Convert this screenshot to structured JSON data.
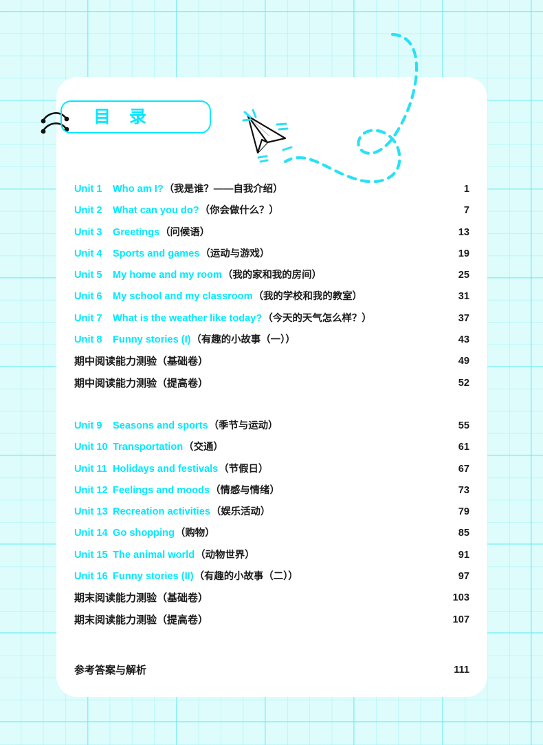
{
  "title": {
    "heading": "目 录"
  },
  "decor": {
    "paper_plane_icon": "paper-plane-icon",
    "flight_trail_icon": "dashed-flight-path-icon",
    "squiggle_icon": "double-arc-squiggle-icon"
  },
  "colors": {
    "accent_cyan": "#00e8ff",
    "grid_line": "#8af1f6",
    "grid_bg": "#ddfcfb",
    "card_bg": "#ffffff",
    "text_black": "#1a1a1a"
  },
  "toc": {
    "block1": [
      {
        "unit": "Unit 1",
        "en": "Who am I?",
        "cn": "（我是谁？——自我介绍）",
        "page": "1"
      },
      {
        "unit": "Unit 2",
        "en": "What can you do?",
        "cn": "（你会做什么？）",
        "page": "7"
      },
      {
        "unit": "Unit 3",
        "en": "Greetings",
        "cn": "（问候语）",
        "page": "13"
      },
      {
        "unit": "Unit 4",
        "en": "Sports and games",
        "cn": "（运动与游戏）",
        "page": "19"
      },
      {
        "unit": "Unit 5",
        "en": "My home and my room",
        "cn": "（我的家和我的房间）",
        "page": "25"
      },
      {
        "unit": "Unit 6",
        "en": "My school and my classroom",
        "cn": "（我的学校和我的教室）",
        "page": "31"
      },
      {
        "unit": "Unit 7",
        "en": "What is the weather like today?",
        "cn": "（今天的天气怎么样？）",
        "page": "37"
      },
      {
        "unit": "Unit 8",
        "en": "Funny stories (I)",
        "cn": "（有趣的小故事（一））",
        "page": "43"
      }
    ],
    "block1_tests": [
      {
        "label": "期中阅读能力测验（基础卷）",
        "page": "49"
      },
      {
        "label": "期中阅读能力测验（提高卷）",
        "page": "52"
      }
    ],
    "block2": [
      {
        "unit": "Unit 9",
        "en": "Seasons and sports",
        "cn": "（季节与运动）",
        "page": "55"
      },
      {
        "unit": "Unit 10",
        "en": "Transportation",
        "cn": "（交通）",
        "page": "61"
      },
      {
        "unit": "Unit 11",
        "en": "Holidays and festivals",
        "cn": "（节假日）",
        "page": "67"
      },
      {
        "unit": "Unit 12",
        "en": "Feelings and moods",
        "cn": "（情感与情绪）",
        "page": "73"
      },
      {
        "unit": "Unit 13",
        "en": "Recreation activities",
        "cn": "（娱乐活动）",
        "page": "79"
      },
      {
        "unit": "Unit 14",
        "en": "Go shopping",
        "cn": "（购物）",
        "page": "85"
      },
      {
        "unit": "Unit 15",
        "en": "The animal world",
        "cn": "（动物世界）",
        "page": "91"
      },
      {
        "unit": "Unit 16",
        "en": "Funny stories (II)",
        "cn": "（有趣的小故事（二））",
        "page": "97"
      }
    ],
    "block2_tests": [
      {
        "label": "期末阅读能力测验（基础卷）",
        "page": "103"
      },
      {
        "label": "期末阅读能力测验（提高卷）",
        "page": "107"
      }
    ],
    "answers": {
      "label": "参考答案与解析",
      "page": "111"
    }
  }
}
